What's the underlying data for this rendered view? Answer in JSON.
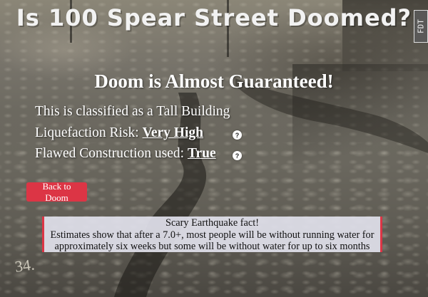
{
  "page": {
    "title": "Is 100 Spear Street Doomed?",
    "verdict": "Doom is Almost Guaranteed!"
  },
  "badge": {
    "text": "FDT"
  },
  "details": {
    "classification": "This is classified as a Tall Building",
    "liquefaction_label": "Liquefaction Risk: ",
    "liquefaction_value": "Very High",
    "flawed_label": "Flawed Construction used: ",
    "flawed_value": "True",
    "help_glyph": "?"
  },
  "actions": {
    "back_label": "Back to Doom"
  },
  "fact": {
    "heading": "Scary Earthquake fact!",
    "body": "Estimates show that after a 7.0+, most people will be without running water for approximately six weeks but some will be without water for up to six months"
  },
  "background": {
    "photo_label": "34."
  },
  "colors": {
    "button": "#dc3545",
    "fact_border": "#dc3545",
    "fact_bg": "#e1e1eb",
    "text": "#ffffff"
  }
}
